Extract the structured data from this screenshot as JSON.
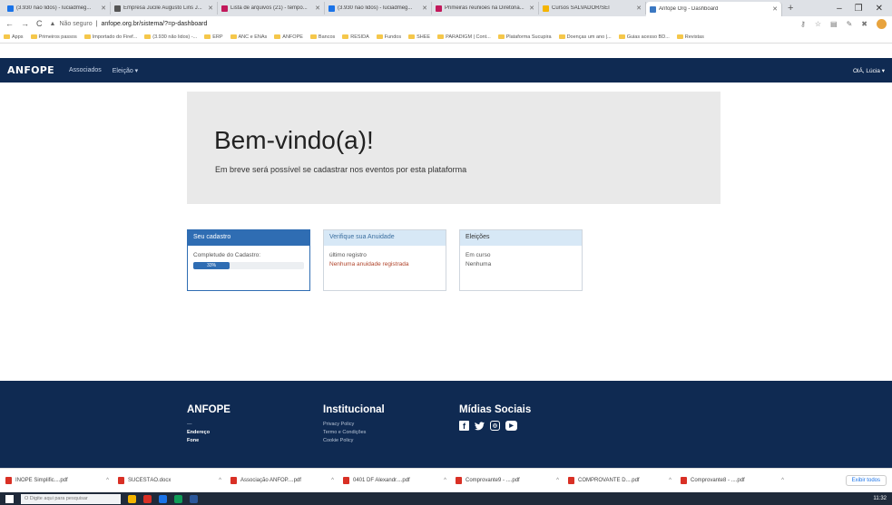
{
  "browser": {
    "tabs": [
      {
        "title": "(3.930 não lidos) - luciadmeg...",
        "color": "#1a73e8"
      },
      {
        "title": "Empresa Jucile Augusto Lins J...",
        "color": "#555"
      },
      {
        "title": "Lista de arquivos (21) - tempo...",
        "color": "#c2185b"
      },
      {
        "title": "(3.930 não lidos) - luciadmeg...",
        "color": "#1a73e8"
      },
      {
        "title": "Primeiras reuniões na Diretoria...",
        "color": "#c2185b"
      },
      {
        "title": "Cursos SALVADOR/SEI",
        "color": "#f4b400"
      },
      {
        "title": "Anfope Org - Dashboard",
        "color": "#3b78c2",
        "active": true
      }
    ],
    "new_tab": "+",
    "win_controls": [
      "–",
      "❐",
      "✕"
    ],
    "security_label": "Não seguro",
    "url": "anfope.org.br/sistema/?=p-dashboard",
    "bookmarks": [
      {
        "label": "Apps"
      },
      {
        "label": "Primeiros passos"
      },
      {
        "label": "Importado do Firef..."
      },
      {
        "label": "(3.930 não lidos) -..."
      },
      {
        "label": "ERP"
      },
      {
        "label": "ANC e ENAs"
      },
      {
        "label": "ANFOPE"
      },
      {
        "label": "Bancos"
      },
      {
        "label": "RESIDA"
      },
      {
        "label": "Fundos"
      },
      {
        "label": "SHEE"
      },
      {
        "label": "PARADIGM | Cont..."
      },
      {
        "label": "Plataforma Sucupira"
      },
      {
        "label": "Doenças um ano |..."
      },
      {
        "label": "Guias acesso BD..."
      },
      {
        "label": "Revistas"
      }
    ]
  },
  "site": {
    "logo": "ANFOPE",
    "nav": [
      "Associados",
      "Eleição ▾"
    ],
    "user": "OlÁ, Lúcia ▾"
  },
  "jumbotron": {
    "title": "Bem-vindo(a)!",
    "subtitle": "Em breve será possível se cadastrar nos eventos por esta plataforma"
  },
  "cards": {
    "cadastro": {
      "title": "Seu cadastro",
      "label": "Completude do Cadastro:",
      "progress_text": "33%",
      "progress_value": 0.33
    },
    "anuidade": {
      "title": "Verifique sua Anuidade",
      "line1": "último registro",
      "line2": "Nenhuma anuidade registrada"
    },
    "eleicoes": {
      "title": "Eleições",
      "line1": "Em curso",
      "line2": "Nenhuma"
    }
  },
  "footer": {
    "col1": {
      "title": "ANFOPE",
      "lines": [
        "—",
        "Endereço",
        "Fone"
      ]
    },
    "col2": {
      "title": "Institucional",
      "lines": [
        "Privacy Policy",
        "Termo e Condições",
        "Cookie Policy"
      ]
    },
    "col3": {
      "title": "Mídias Sociais",
      "icons": [
        "facebook-icon",
        "twitter-icon",
        "instagram-icon",
        "youtube-icon"
      ]
    }
  },
  "downloads": {
    "items": [
      "INOPE Simplific....pdf",
      "SUCESTÃO.docx",
      "Associação ANFOP....pdf",
      "0401 DF Alexandr....pdf",
      "Comprovante9 - ....pdf",
      "COMPROVANTE D....pdf",
      "Comprovante8 - ....pdf"
    ],
    "show_all": "Exibir todos"
  },
  "taskbar": {
    "search_placeholder": "O Digite aqui para pesquisar",
    "clock": "11:32"
  }
}
